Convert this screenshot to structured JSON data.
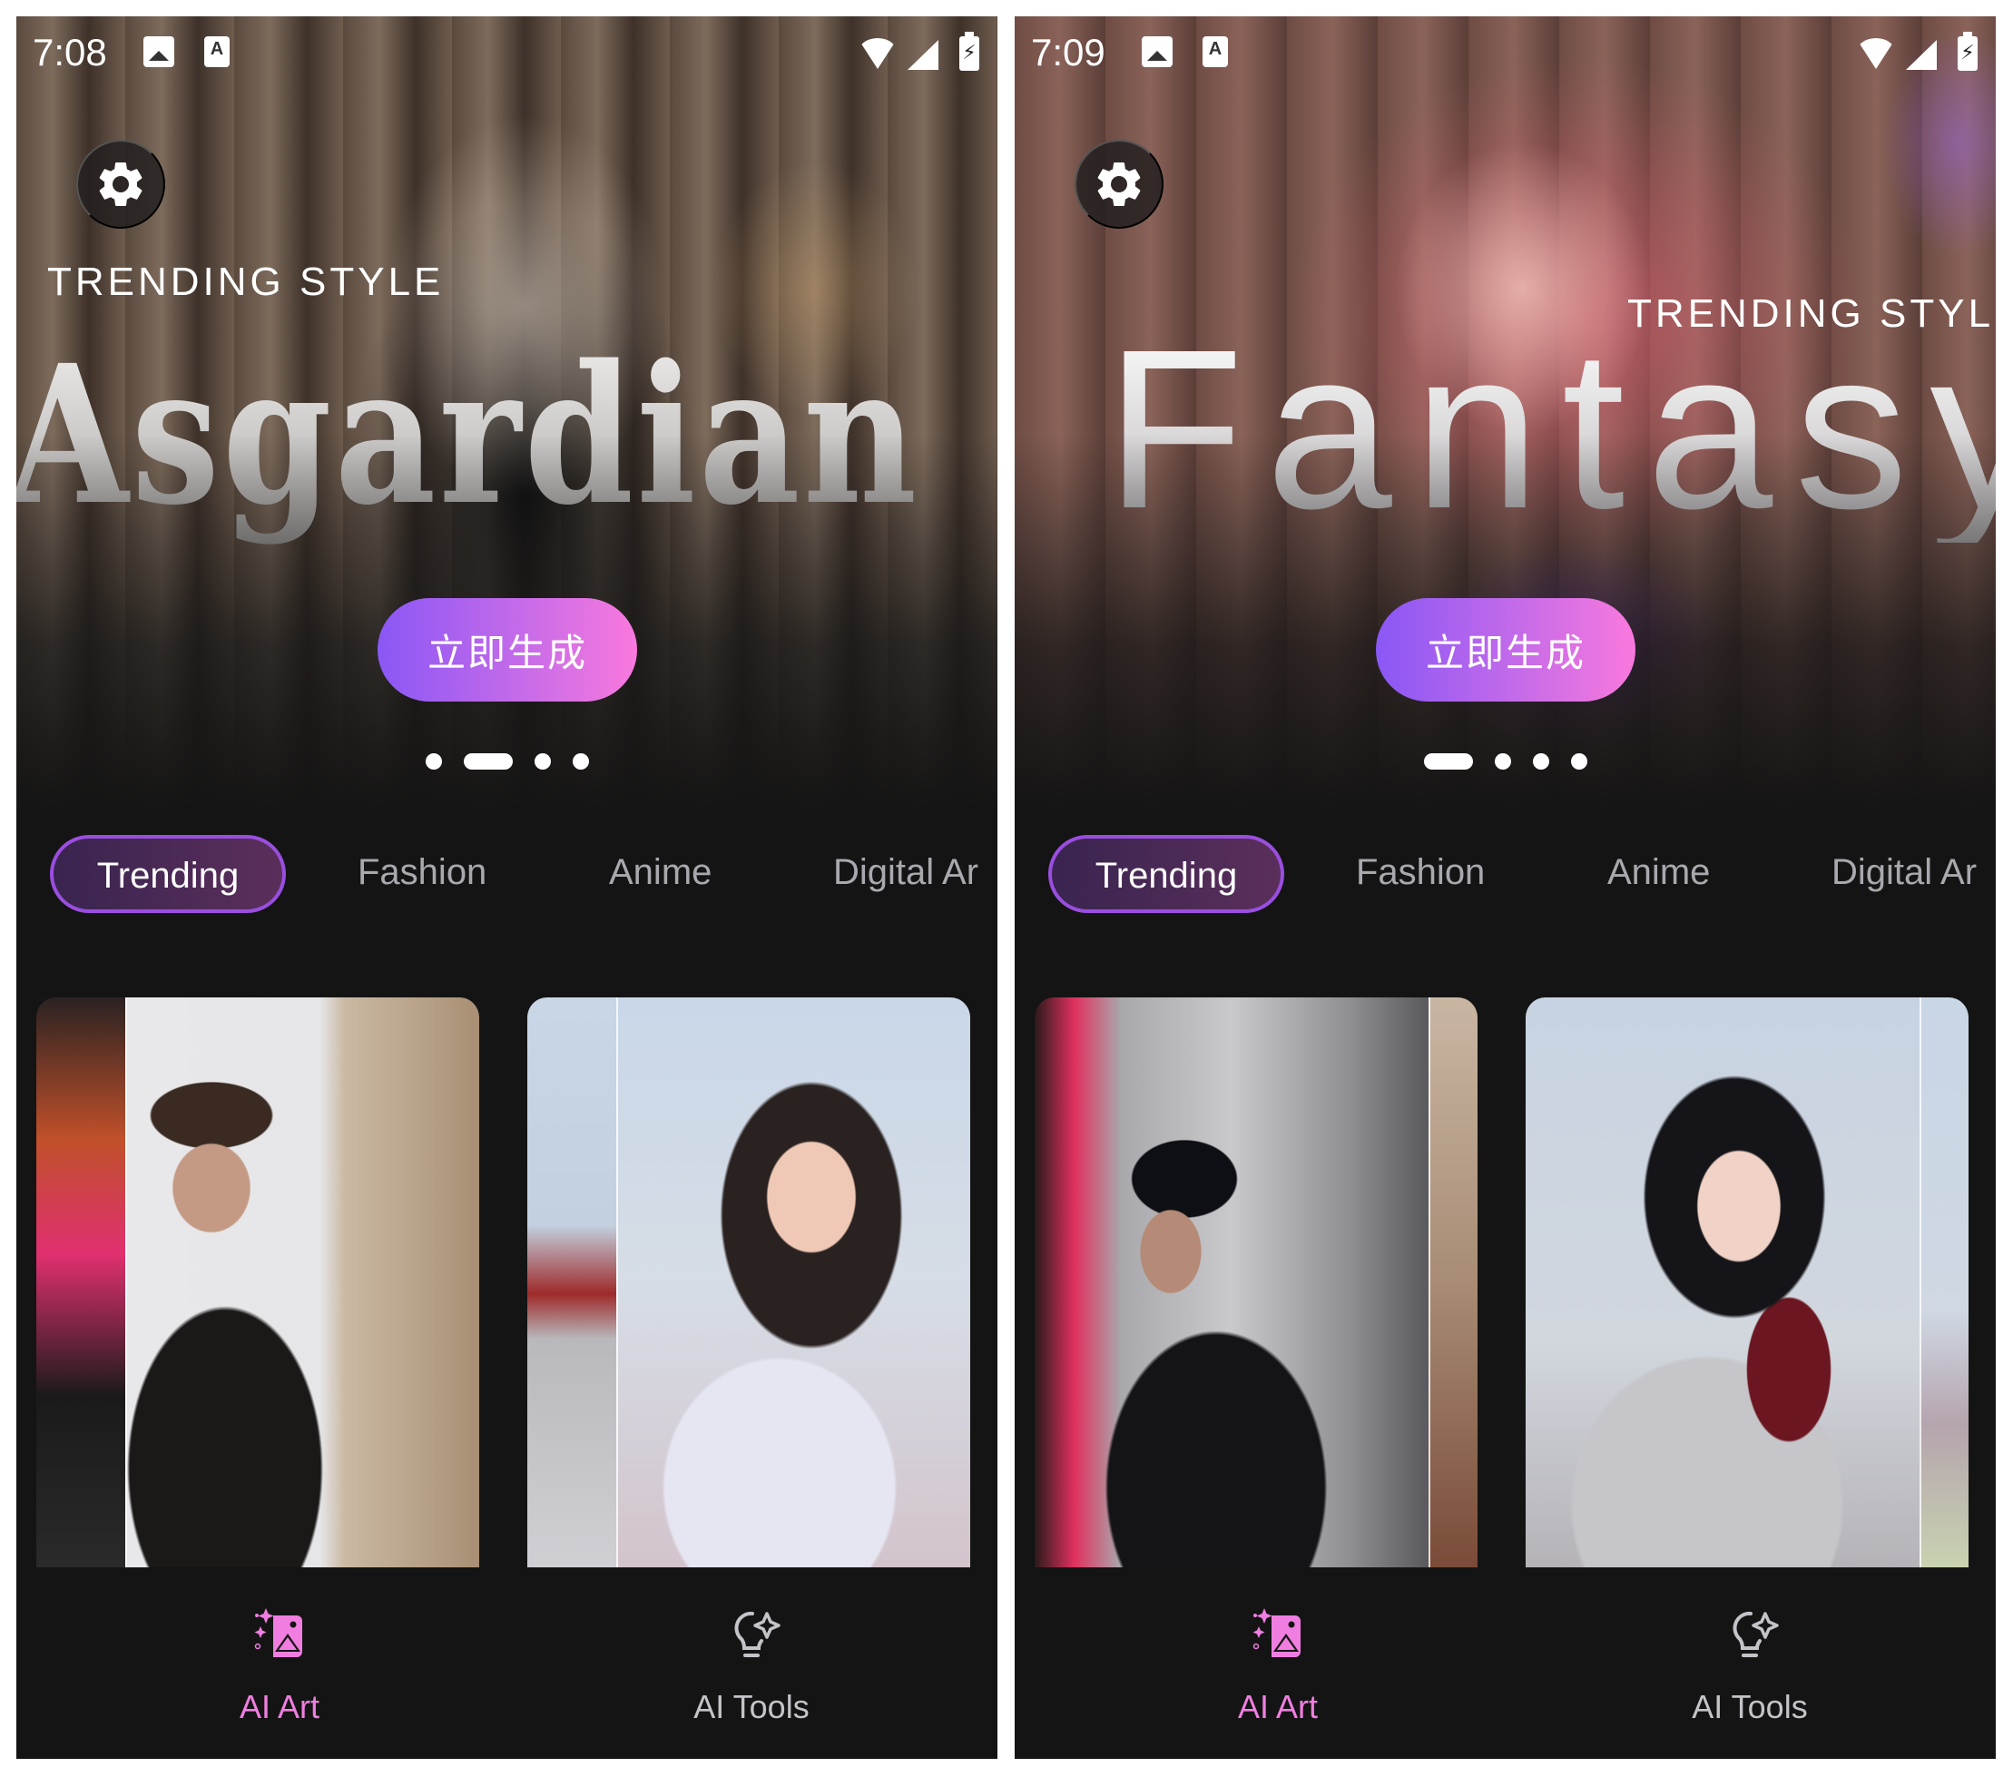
{
  "screens": [
    {
      "status": {
        "time": "7:08",
        "icons": [
          "image-icon",
          "a-notification-icon",
          "wifi-icon",
          "signal-icon",
          "battery-charging-icon"
        ]
      },
      "hero": {
        "kicker": "TRENDING STYLE",
        "title": "Asgardian",
        "cta": "立即生成",
        "carousel": {
          "count": 4,
          "active": 2
        }
      },
      "tabs": [
        "Trending",
        "Fashion",
        "Anime",
        "Digital Ar"
      ],
      "active_tab": "Trending",
      "cards": [
        {
          "name": "before-after-card-man-paris",
          "split": 0.2
        },
        {
          "name": "before-after-card-woman-flowers",
          "split": 0.2
        }
      ],
      "nav": [
        {
          "label": "AI Art",
          "active": true
        },
        {
          "label": "AI Tools",
          "active": false
        }
      ]
    },
    {
      "status": {
        "time": "7:09",
        "icons": [
          "image-icon",
          "a-notification-icon",
          "wifi-icon",
          "signal-icon",
          "battery-charging-icon"
        ]
      },
      "hero": {
        "kicker": "TRENDING STYLE",
        "title": "Fantasy",
        "cta": "立即生成",
        "carousel": {
          "count": 4,
          "active": 1
        }
      },
      "tabs": [
        "Trending",
        "Fashion",
        "Anime",
        "Digital Ar"
      ],
      "active_tab": "Trending",
      "cards": [
        {
          "name": "before-after-card-cyberpunk-man",
          "split": 0.89
        },
        {
          "name": "before-after-card-anime-girl",
          "split": 0.89
        }
      ],
      "nav": [
        {
          "label": "AI Art",
          "active": true
        },
        {
          "label": "AI Tools",
          "active": false
        }
      ]
    }
  ],
  "colors": {
    "background": "#141414",
    "accent_pink": "#f07ee0",
    "accent_purple": "#9a4ee0",
    "cta_gradient": [
      "#8a57f5",
      "#f979dd"
    ],
    "tab_inactive": "#a9a8ae",
    "nav_inactive": "#c4c3c8"
  }
}
